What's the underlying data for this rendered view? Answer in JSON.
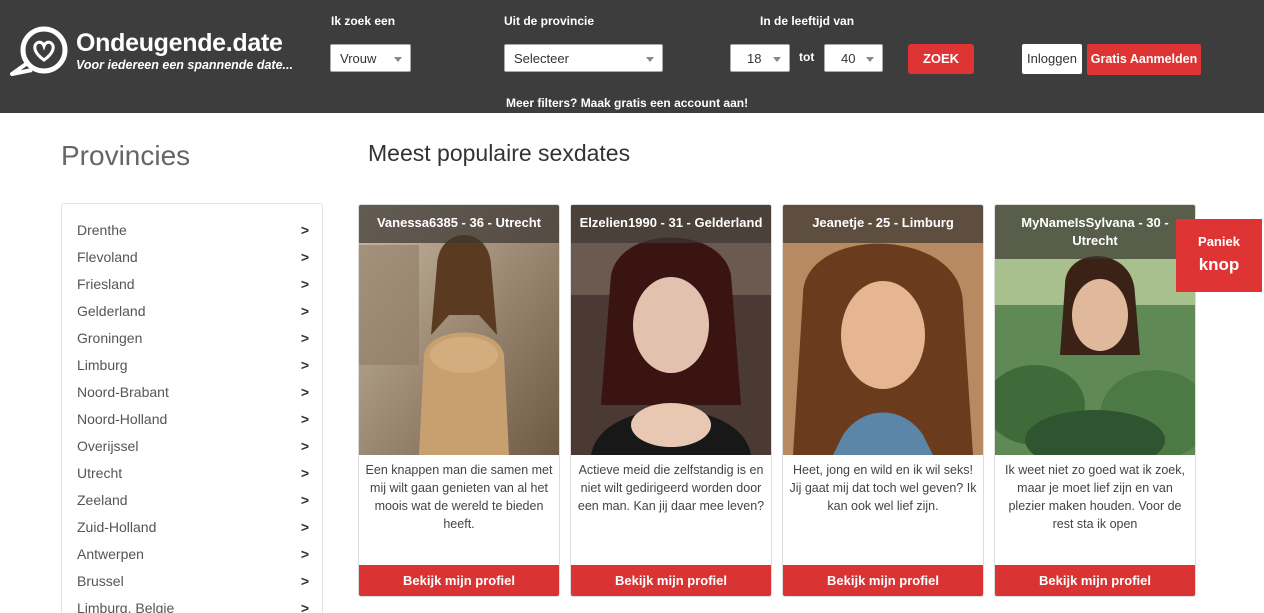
{
  "brand": {
    "title": "Ondeugende.date",
    "tagline": "Voor iedereen een spannende date..."
  },
  "search": {
    "seeking_label": "Ik zoek een",
    "seeking_value": "Vrouw",
    "province_label": "Uit de provincie",
    "province_value": "Selecteer",
    "age_label": "In de leeftijd van",
    "age_min": "18",
    "age_to": "tot",
    "age_max": "40",
    "submit_label": "ZOEK",
    "more_filters_prefix": "Meer filters? Maak ",
    "more_filters_bold": "gratis",
    "more_filters_suffix": " een account aan!"
  },
  "auth": {
    "login_label": "Inloggen",
    "signup_label": "Gratis Aanmelden"
  },
  "sidebar": {
    "title": "Provincies",
    "chevron": ">",
    "items": [
      "Drenthe",
      "Flevoland",
      "Friesland",
      "Gelderland",
      "Groningen",
      "Limburg",
      "Noord-Brabant",
      "Noord-Holland",
      "Overijssel",
      "Utrecht",
      "Zeeland",
      "Zuid-Holland",
      "Antwerpen",
      "Brussel",
      "Limburg, Belgie"
    ]
  },
  "main": {
    "title": "Meest populaire sexdates",
    "profiles": [
      {
        "caption": "Vanessa6385 - 36 - Utrecht",
        "description": "Een knappen man die samen met mij wilt gaan genieten van al het moois wat de wereld te bieden heeft.",
        "cta": "Bekijk mijn profiel"
      },
      {
        "caption": "Elzelien1990 - 31 - Gelderland",
        "description": "Actieve meid die zelfstandig is en niet wilt gedirigeerd worden door een man. Kan jij daar mee leven?",
        "cta": "Bekijk mijn profiel"
      },
      {
        "caption": "Jeanetje - 25 - Limburg",
        "description": "Heet, jong en wild en ik wil seks! Jij gaat mij dat toch wel geven? Ik kan ook wel lief zijn.",
        "cta": "Bekijk mijn profiel"
      },
      {
        "caption": "MyNameIsSylvana - 30 - Utrecht",
        "description": "Ik weet niet zo goed wat ik zoek, maar je moet lief zijn en van plezier maken houden. Voor de rest sta ik open",
        "cta": "Bekijk mijn profiel"
      }
    ]
  },
  "panic": {
    "line1": "Paniek",
    "line2": "knop"
  },
  "colors": {
    "header_bg": "#3d3d3d",
    "accent_red": "#de3434",
    "text_gray": "#555555"
  },
  "icons": {
    "logo": "heart-speech-bubble-icon",
    "dropdown": "caret-down-icon",
    "list_arrow": "chevron-right-icon"
  }
}
